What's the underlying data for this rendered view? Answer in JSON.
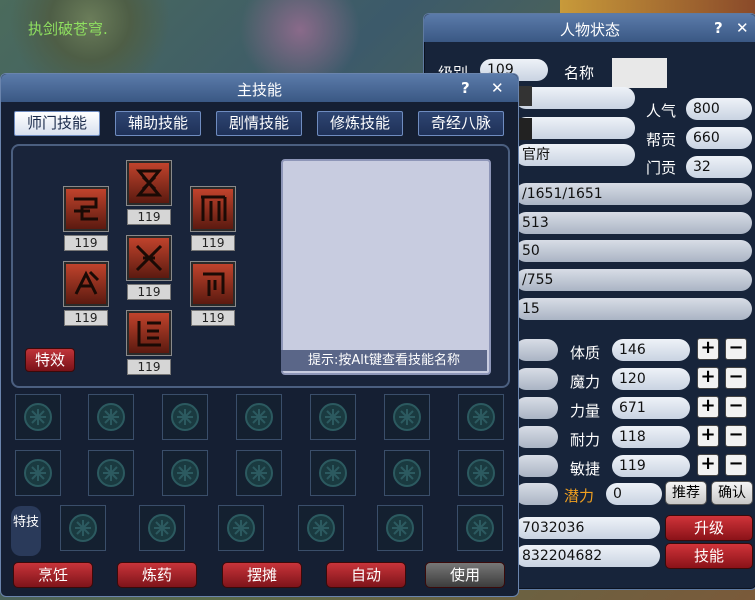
{
  "world": {
    "caption": "执剑破苍穹."
  },
  "status": {
    "title": "人物状态",
    "help": "?",
    "close": "✕",
    "level_label": "级别",
    "level_value": "109",
    "name_label": "名称",
    "popularity_label": "人气",
    "popularity_value": "800",
    "contribution_label": "帮贡",
    "contribution_value": "660",
    "sect_value": "官府",
    "sect_contribution_label": "门贡",
    "sect_contribution_value": "32",
    "rows": [
      "/1651/1651",
      "513",
      "50",
      "/755",
      "15"
    ],
    "attributes": [
      {
        "label": "体质",
        "value": "146"
      },
      {
        "label": "魔力",
        "value": "120"
      },
      {
        "label": "力量",
        "value": "671"
      },
      {
        "label": "耐力",
        "value": "118"
      },
      {
        "label": "敏捷",
        "value": "119"
      }
    ],
    "plus": "+",
    "minus": "−",
    "potential_label": "潜力",
    "potential_value": "0",
    "recommend": "推荐",
    "confirm": "确认",
    "exp_value": "7032036",
    "exp_next_value": "832204682",
    "upgrade": "升级",
    "skills": "技能"
  },
  "skills_panel": {
    "title": "主技能",
    "help": "?",
    "close": "✕",
    "tabs": [
      "师门技能",
      "辅助技能",
      "剧情技能",
      "修炼技能",
      "奇经八脉"
    ],
    "levels": [
      "119",
      "119",
      "119",
      "119",
      "119",
      "119",
      "119"
    ],
    "effect_button": "特效",
    "hint": "提示:按Alt键查看技能名称",
    "stunt_label": "特技",
    "bottom_buttons": [
      "烹饪",
      "炼药",
      "摆摊",
      "自动",
      "使用"
    ]
  },
  "colors": {
    "accent": "#5b7baa",
    "potential": "#f0a020",
    "world_text": "#8fe060"
  }
}
